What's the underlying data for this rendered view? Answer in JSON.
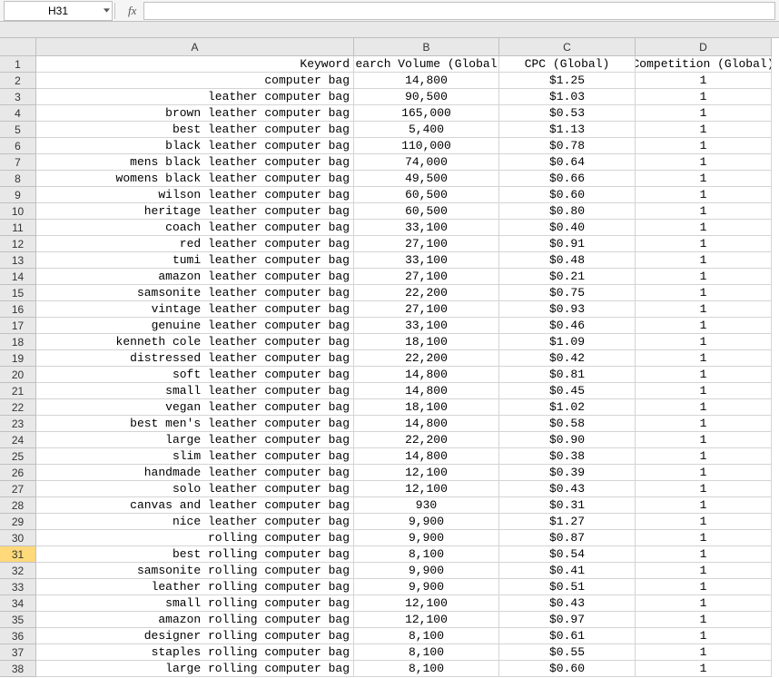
{
  "formulaBar": {
    "nameBox": "H31",
    "fxLabel": "fx",
    "formulaValue": ""
  },
  "columns": [
    "A",
    "B",
    "C",
    "D"
  ],
  "activeRow": 31,
  "headerRow": {
    "a": "Keyword",
    "b": "earch Volume (Global",
    "c": "CPC (Global)",
    "d": "Competition (Global)"
  },
  "rows": [
    {
      "n": 2,
      "a": "computer bag",
      "b": "14,800",
      "c": "$1.25",
      "d": "1"
    },
    {
      "n": 3,
      "a": "leather computer bag",
      "b": "90,500",
      "c": "$1.03",
      "d": "1"
    },
    {
      "n": 4,
      "a": "brown leather computer bag",
      "b": "165,000",
      "c": "$0.53",
      "d": "1"
    },
    {
      "n": 5,
      "a": "best leather computer bag",
      "b": "5,400",
      "c": "$1.13",
      "d": "1"
    },
    {
      "n": 6,
      "a": "black leather computer bag",
      "b": "110,000",
      "c": "$0.78",
      "d": "1"
    },
    {
      "n": 7,
      "a": "mens black leather computer bag",
      "b": "74,000",
      "c": "$0.64",
      "d": "1"
    },
    {
      "n": 8,
      "a": "womens black leather computer bag",
      "b": "49,500",
      "c": "$0.66",
      "d": "1"
    },
    {
      "n": 9,
      "a": "wilson leather computer bag",
      "b": "60,500",
      "c": "$0.60",
      "d": "1"
    },
    {
      "n": 10,
      "a": "heritage leather computer bag",
      "b": "60,500",
      "c": "$0.80",
      "d": "1"
    },
    {
      "n": 11,
      "a": "coach leather computer bag",
      "b": "33,100",
      "c": "$0.40",
      "d": "1"
    },
    {
      "n": 12,
      "a": "red leather computer bag",
      "b": "27,100",
      "c": "$0.91",
      "d": "1"
    },
    {
      "n": 13,
      "a": "tumi leather computer bag",
      "b": "33,100",
      "c": "$0.48",
      "d": "1"
    },
    {
      "n": 14,
      "a": "amazon leather computer bag",
      "b": "27,100",
      "c": "$0.21",
      "d": "1"
    },
    {
      "n": 15,
      "a": "samsonite leather computer bag",
      "b": "22,200",
      "c": "$0.75",
      "d": "1"
    },
    {
      "n": 16,
      "a": "vintage leather computer bag",
      "b": "27,100",
      "c": "$0.93",
      "d": "1"
    },
    {
      "n": 17,
      "a": "genuine leather computer bag",
      "b": "33,100",
      "c": "$0.46",
      "d": "1"
    },
    {
      "n": 18,
      "a": "kenneth cole leather computer bag",
      "b": "18,100",
      "c": "$1.09",
      "d": "1"
    },
    {
      "n": 19,
      "a": "distressed leather computer bag",
      "b": "22,200",
      "c": "$0.42",
      "d": "1"
    },
    {
      "n": 20,
      "a": "soft leather computer bag",
      "b": "14,800",
      "c": "$0.81",
      "d": "1"
    },
    {
      "n": 21,
      "a": "small leather computer bag",
      "b": "14,800",
      "c": "$0.45",
      "d": "1"
    },
    {
      "n": 22,
      "a": "vegan leather computer bag",
      "b": "18,100",
      "c": "$1.02",
      "d": "1"
    },
    {
      "n": 23,
      "a": "best men's leather computer bag",
      "b": "14,800",
      "c": "$0.58",
      "d": "1"
    },
    {
      "n": 24,
      "a": "large leather computer bag",
      "b": "22,200",
      "c": "$0.90",
      "d": "1"
    },
    {
      "n": 25,
      "a": "slim leather computer bag",
      "b": "14,800",
      "c": "$0.38",
      "d": "1"
    },
    {
      "n": 26,
      "a": "handmade leather computer bag",
      "b": "12,100",
      "c": "$0.39",
      "d": "1"
    },
    {
      "n": 27,
      "a": "solo leather computer bag",
      "b": "12,100",
      "c": "$0.43",
      "d": "1"
    },
    {
      "n": 28,
      "a": "canvas and leather computer bag",
      "b": "930",
      "c": "$0.31",
      "d": "1"
    },
    {
      "n": 29,
      "a": "nice leather computer bag",
      "b": "9,900",
      "c": "$1.27",
      "d": "1"
    },
    {
      "n": 30,
      "a": "rolling computer bag",
      "b": "9,900",
      "c": "$0.87",
      "d": "1"
    },
    {
      "n": 31,
      "a": "best rolling computer bag",
      "b": "8,100",
      "c": "$0.54",
      "d": "1"
    },
    {
      "n": 32,
      "a": "samsonite rolling computer bag",
      "b": "9,900",
      "c": "$0.41",
      "d": "1"
    },
    {
      "n": 33,
      "a": "leather rolling computer bag",
      "b": "9,900",
      "c": "$0.51",
      "d": "1"
    },
    {
      "n": 34,
      "a": "small rolling computer bag",
      "b": "12,100",
      "c": "$0.43",
      "d": "1"
    },
    {
      "n": 35,
      "a": "amazon rolling computer bag",
      "b": "12,100",
      "c": "$0.97",
      "d": "1"
    },
    {
      "n": 36,
      "a": "designer rolling computer bag",
      "b": "8,100",
      "c": "$0.61",
      "d": "1"
    },
    {
      "n": 37,
      "a": "staples rolling computer bag",
      "b": "8,100",
      "c": "$0.55",
      "d": "1"
    },
    {
      "n": 38,
      "a": "large rolling computer bag",
      "b": "8,100",
      "c": "$0.60",
      "d": "1"
    }
  ]
}
